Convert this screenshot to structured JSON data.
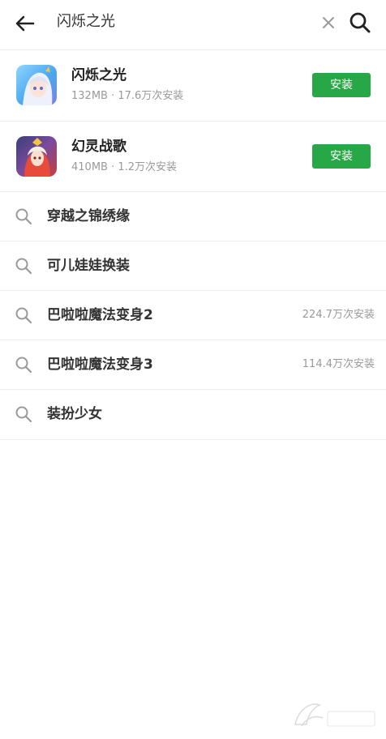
{
  "search": {
    "query": "闪烁之光"
  },
  "apps": [
    {
      "name": "闪烁之光",
      "size": "132MB",
      "installs": "17.6万次安装",
      "meta": "132MB · 17.6万次安装",
      "button": "安装"
    },
    {
      "name": "幻灵战歌",
      "size": "410MB",
      "installs": "1.2万次安装",
      "meta": "410MB · 1.2万次安装",
      "button": "安装"
    }
  ],
  "suggestions": [
    {
      "text": "穿越之锦绣缘",
      "count": ""
    },
    {
      "text": "可儿娃娃换装",
      "count": ""
    },
    {
      "text": "巴啦啦魔法变身2",
      "count": "224.7万次安装"
    },
    {
      "text": "巴啦啦魔法变身3",
      "count": "114.4万次安装"
    },
    {
      "text": "装扮少女",
      "count": ""
    }
  ],
  "colors": {
    "install_button": "#27a745",
    "divider": "#ececec",
    "meta_text": "#9a9a9a"
  },
  "icons": {
    "back": "arrow-left-icon",
    "clear": "close-icon",
    "search": "search-icon",
    "suggestion": "search-icon"
  }
}
